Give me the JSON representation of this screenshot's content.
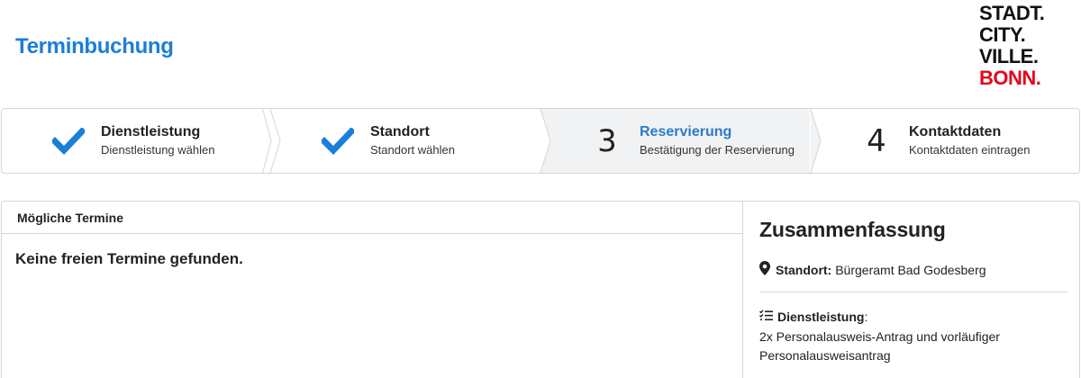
{
  "header": {
    "title": "Terminbuchung",
    "logo": {
      "line1": "STADT.",
      "line2": "CITY.",
      "line3": "VILLE.",
      "line4": "BONN."
    }
  },
  "steps": [
    {
      "marker": "check",
      "name": "Dienstleistung",
      "sub": "Dienstleistung wählen",
      "state": "done"
    },
    {
      "marker": "check",
      "name": "Standort",
      "sub": "Standort wählen",
      "state": "done"
    },
    {
      "marker": "3",
      "name": "Reservierung",
      "sub": "Bestätigung der Reservierung",
      "state": "active"
    },
    {
      "marker": "4",
      "name": "Kontaktdaten",
      "sub": "Kontaktdaten eintragen",
      "state": "pending"
    }
  ],
  "appointments": {
    "heading": "Mögliche Termine",
    "empty_message": "Keine freien Termine gefunden."
  },
  "summary": {
    "title": "Zusammenfassung",
    "location_label": "Standort:",
    "location_value": "Bürgeramt Bad Godesberg",
    "location_icon": "map-marker-icon",
    "service_label": "Dienstleistung",
    "service_colon": ":",
    "service_value": "2x Personalausweis-Antrag und vorläufiger Personalausweisantrag",
    "service_icon": "list-check-icon"
  },
  "colors": {
    "accent": "#1a7fd8",
    "active_step_text": "#2a7cc7",
    "active_step_bg": "#f1f2f4",
    "logo_red": "#e2061a",
    "check": "#1a7fd8"
  }
}
